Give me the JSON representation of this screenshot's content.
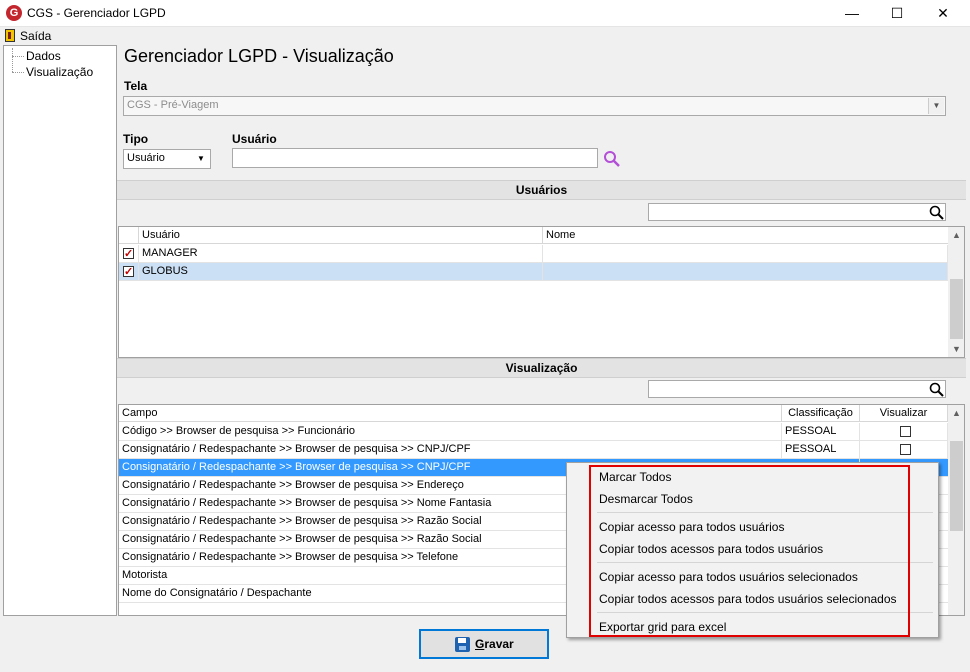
{
  "window": {
    "title": "CGS - Gerenciador LGPD",
    "minimize": "—",
    "maximize": "☐",
    "close": "✕"
  },
  "menu": {
    "exit_label": "Saída"
  },
  "tree": {
    "items": [
      "Dados",
      "Visualização"
    ]
  },
  "page": {
    "title": "Gerenciador LGPD - Visualização"
  },
  "tela": {
    "label": "Tela",
    "value": "CGS - Pré-Viagem"
  },
  "tipo": {
    "label": "Tipo",
    "value": "Usuário"
  },
  "usuario": {
    "label": "Usuário",
    "value": ""
  },
  "users_section": {
    "title": "Usuários",
    "search_value": "",
    "columns": [
      "Usuário",
      "Nome"
    ],
    "rows": [
      {
        "checked": true,
        "user": "MANAGER",
        "name": ""
      },
      {
        "checked": true,
        "user": "GLOBUS",
        "name": ""
      }
    ]
  },
  "view_section": {
    "title": "Visualização",
    "search_value": "",
    "columns": [
      "Campo",
      "Classificação",
      "Visualizar"
    ],
    "rows": [
      {
        "campo": "Código >> Browser de pesquisa >> Funcionário",
        "class": "PESSOAL",
        "visualizar": false
      },
      {
        "campo": "Consignatário / Redespachante >> Browser de pesquisa >> CNPJ/CPF",
        "class": "PESSOAL",
        "visualizar": false
      },
      {
        "campo": "Consignatário / Redespachante >> Browser de pesquisa >> CNPJ/CPF",
        "class": "",
        "visualizar": false
      },
      {
        "campo": "Consignatário / Redespachante >> Browser de pesquisa >> Endereço",
        "class": "",
        "visualizar": false
      },
      {
        "campo": "Consignatário / Redespachante >> Browser de pesquisa >> Nome Fantasia",
        "class": "",
        "visualizar": false
      },
      {
        "campo": "Consignatário / Redespachante >> Browser de pesquisa >> Razão Social",
        "class": "",
        "visualizar": false
      },
      {
        "campo": "Consignatário / Redespachante >> Browser de pesquisa >> Razão Social",
        "class": "",
        "visualizar": false
      },
      {
        "campo": "Consignatário / Redespachante >> Browser de pesquisa >> Telefone",
        "class": "",
        "visualizar": false
      },
      {
        "campo": "Motorista",
        "class": "",
        "visualizar": false
      },
      {
        "campo": "Nome do Consignatário / Despachante",
        "class": "",
        "visualizar": false
      }
    ]
  },
  "context_menu": {
    "items": [
      "Marcar Todos",
      "Desmarcar Todos",
      "Copiar acesso para todos usuários",
      "Copiar todos acessos para todos usuários",
      "Copiar acesso para todos usuários selecionados",
      "Copiar todos acessos para todos usuários selecionados",
      "Exportar grid para excel"
    ]
  },
  "footer": {
    "save_label_first": "G",
    "save_label_rest": "ravar"
  },
  "colors": {
    "selection": "#3399ff",
    "highlight_border": "#e00000",
    "brand": "#c4262e",
    "search_icon": "#b24fd6"
  }
}
